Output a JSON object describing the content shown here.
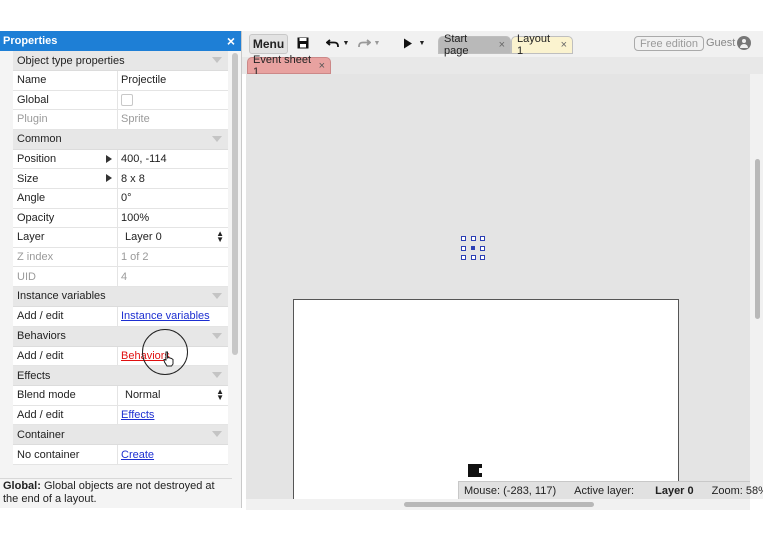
{
  "properties": {
    "title": "Properties",
    "sections": {
      "object_type": "Object type properties",
      "common": "Common",
      "instance_variables": "Instance variables",
      "behaviors": "Behaviors",
      "effects": "Effects",
      "container": "Container"
    },
    "rows": {
      "name": {
        "key": "Name",
        "value": "Projectile"
      },
      "global": {
        "key": "Global",
        "checked": false
      },
      "plugin": {
        "key": "Plugin",
        "value": "Sprite"
      },
      "position": {
        "key": "Position",
        "value": "400, -114"
      },
      "size": {
        "key": "Size",
        "value": "8 x 8"
      },
      "angle": {
        "key": "Angle",
        "value": "0°"
      },
      "opacity": {
        "key": "Opacity",
        "value": "100%"
      },
      "layer": {
        "key": "Layer",
        "value": "Layer 0"
      },
      "zindex": {
        "key": "Z index",
        "value": "1 of 2"
      },
      "uid": {
        "key": "UID",
        "value": "4"
      },
      "inst_vars": {
        "key": "Add / edit",
        "link": "Instance variables"
      },
      "behaviors": {
        "key": "Add / edit",
        "link": "Behaviors"
      },
      "blend_mode": {
        "key": "Blend mode",
        "value": "Normal"
      },
      "effects": {
        "key": "Add / edit",
        "link": "Effects"
      },
      "container": {
        "key": "No container",
        "link": "Create"
      }
    },
    "footer": {
      "bold": "Global:",
      "text": " Global objects are not destroyed at the end of a layout."
    }
  },
  "toolbar": {
    "menu_label": "Menu",
    "tabs": [
      {
        "label": "Start page",
        "active": false
      },
      {
        "label": "Layout 1",
        "active": true
      }
    ],
    "close_glyph": "×",
    "edition_badge": "Free edition",
    "user": "Guest"
  },
  "subtabs": {
    "event_sheet": "Event sheet 1"
  },
  "status": {
    "mouse": "Mouse: (-283, 117)",
    "active_layer_label": "Active layer:",
    "active_layer_value": "Layer 0",
    "zoom": "Zoom: 58%"
  },
  "colors": {
    "title_bar": "#1e7fd6",
    "link": "#1d2fd1",
    "link_active": "#e01010",
    "event_tab": "#e8a2a0",
    "layout_tab": "#fbf3cf"
  }
}
